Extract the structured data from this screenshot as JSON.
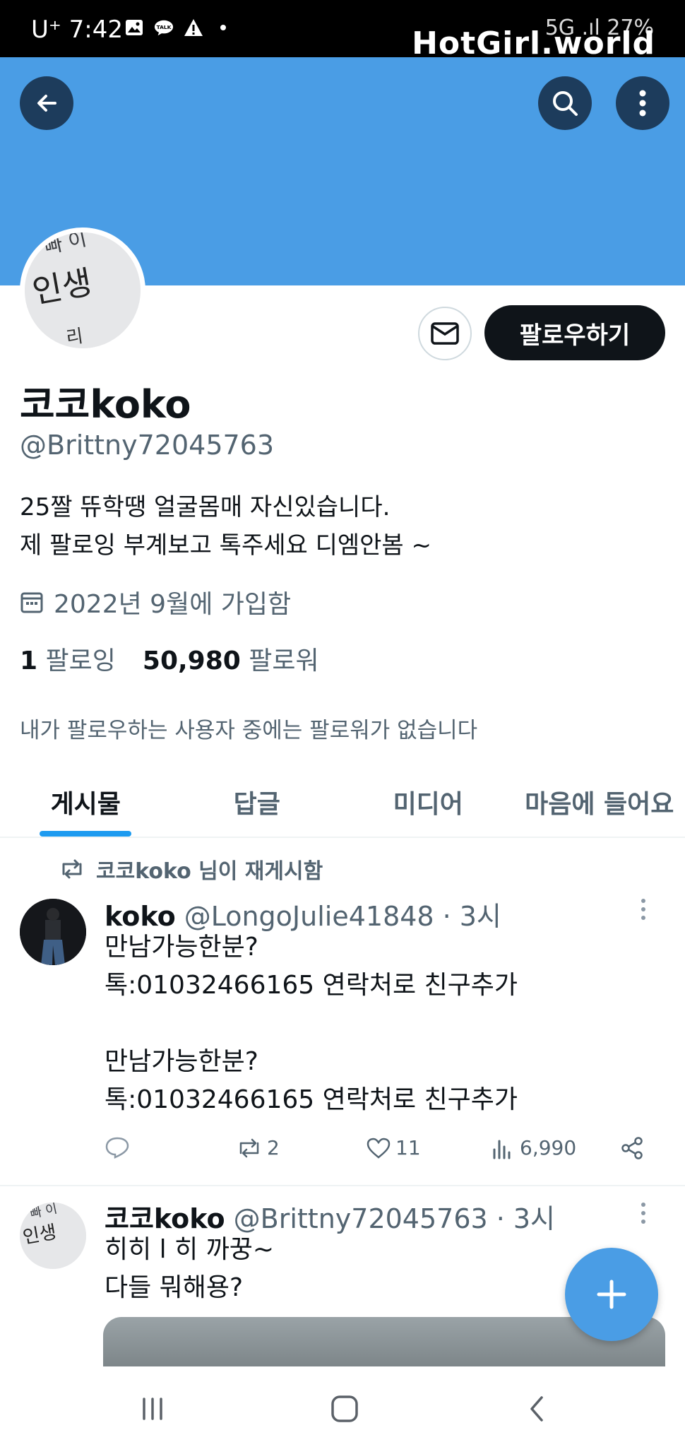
{
  "status_bar": {
    "carrier_time": "U⁺ 7:42",
    "right_text": "5G .ıl 27%",
    "icons": [
      "image-icon",
      "talk-icon",
      "warning-icon",
      "dot-icon"
    ]
  },
  "watermark": "HotGirl.world",
  "profile": {
    "follow_label": "팔로우하기",
    "display_name": "코코koko",
    "handle": "@Brittny72045763",
    "bio_line1": "25짤 뜌학땡 얼굴몸매 자신있습니다.",
    "bio_line2": "제 팔로잉 부계보고 톡주세요 디엠안봄 ~",
    "joined": "2022년 9월에 가입함",
    "following_count": "1",
    "following_label": "팔로잉",
    "followers_count": "50,980",
    "followers_label": "팔로워",
    "no_follower_note": "내가 팔로우하는 사용자 중에는 팔로워가 없습니다"
  },
  "tabs": [
    {
      "label": "게시물",
      "active": true
    },
    {
      "label": "답글",
      "active": false
    },
    {
      "label": "미디어",
      "active": false
    },
    {
      "label": "마음에 들어요",
      "active": false
    }
  ],
  "posts": [
    {
      "repost_label": "코코koko 님이 재게시함",
      "name": "koko",
      "handle": "@LongoJulie41848",
      "time": "· 3시",
      "lines": [
        "만남가능한분?",
        "톡:01032466165 연락처로 친구추가",
        "",
        "만남가능한분?",
        "톡:01032466165 연락처로 친구추가"
      ],
      "reposts": "2",
      "likes": "11",
      "views": "6,990"
    },
    {
      "name": "코코koko",
      "handle": "@Brittny72045763",
      "time": "· 3시",
      "lines": [
        "히히 l 히 까꿍~",
        "다들 뭐해용?"
      ]
    }
  ],
  "avatar_text": [
    "빠 이",
    "인생",
    "리"
  ],
  "colors": {
    "banner": "#4a9de5",
    "accent": "#1d9bf0",
    "text": "#0f1419",
    "muted": "#536471"
  }
}
